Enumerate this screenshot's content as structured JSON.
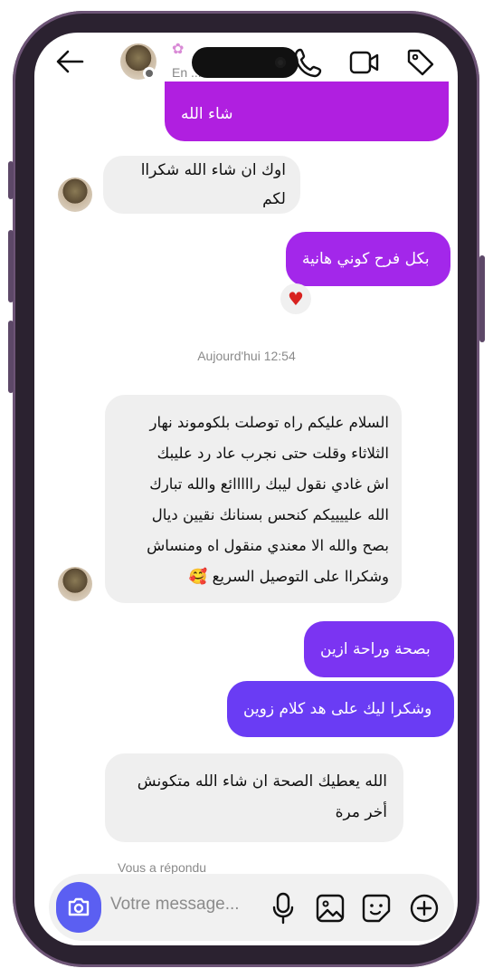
{
  "header": {
    "contact_status": "En ...",
    "back_icon": "arrow-left-icon",
    "call_icon": "phone-icon",
    "video_icon": "video-camera-icon",
    "tag_icon": "tag-icon"
  },
  "messages": {
    "out_1": "شاء الله",
    "in_1": "اوك ان شاء الله شكراا لكم",
    "out_2": "بكل فرح كوني هانية",
    "reaction_1": "♥",
    "timestamp": "Aujourd'hui 12:54",
    "in_2_lines": [
      "السلام عليكم راه توصلت بلكوموند نهار",
      "الثلاثاء وقلت حتى نجرب عاد رد عليبك",
      "اش غادي نقول ليبك رااااائع والله تبارك",
      "الله علييييكم كنحس بسنانك نقيين ديال",
      "بصح والله الا معندي منقول اه ومنساش",
      "وشكراا على التوصيل السريع 🥰"
    ],
    "out_3": "بصحة وراحة ازين",
    "out_4": "وشكرا ليك على هد كلام زوين",
    "in_3_lines": [
      "الله يعطيك الصحة ان شاء الله متكونش",
      "أخر مرة"
    ],
    "replied_note": "Vous a répondu"
  },
  "composer": {
    "placeholder": "Votre message...",
    "camera_icon": "camera-icon",
    "mic_icon": "microphone-icon",
    "gallery_icon": "image-icon",
    "sticker_icon": "sticker-icon",
    "add_icon": "plus-circle-icon"
  },
  "colors": {
    "outgoing_magenta": "#b01fe0",
    "outgoing_purple": "#8a2cf0",
    "outgoing_violet": "#6a3cf4",
    "incoming_bg": "#efefef",
    "camera_btn": "#5b5ff2",
    "heart": "#d8221f"
  }
}
